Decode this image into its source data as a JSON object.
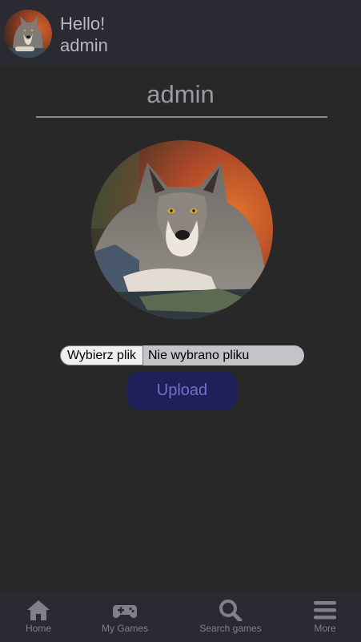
{
  "header": {
    "greeting": "Hello!",
    "username": "admin"
  },
  "profile": {
    "username": "admin"
  },
  "file_input": {
    "button_label": "Wybierz plik",
    "status_text": "Nie wybrano pliku"
  },
  "upload": {
    "label": "Upload"
  },
  "bottom_nav": {
    "items": [
      {
        "label": "Home",
        "icon": "home-icon"
      },
      {
        "label": "My Games",
        "icon": "gamepad-icon"
      },
      {
        "label": "Search games",
        "icon": "search-icon"
      },
      {
        "label": "More",
        "icon": "menu-icon"
      }
    ]
  }
}
